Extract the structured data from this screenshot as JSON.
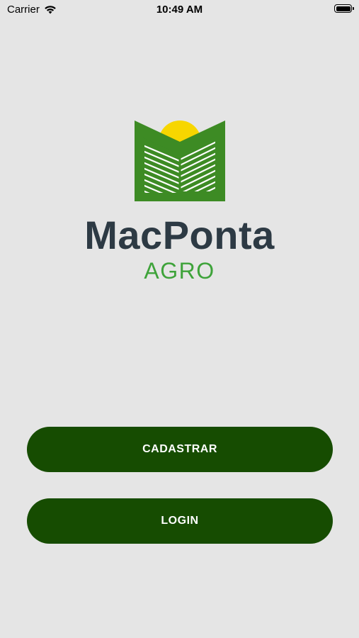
{
  "status_bar": {
    "carrier": "Carrier",
    "time": "10:49 AM",
    "wifi_icon": "wifi-icon",
    "battery_icon": "battery-icon",
    "battery_level": 1.0
  },
  "logo": {
    "icon": "field-sun-logo-icon",
    "brand_name": "MacPonta",
    "brand_sub": "AGRO",
    "colors": {
      "sun": "#f7d600",
      "green": "#3d8b24",
      "dark_text": "#2d3a44",
      "sub_text": "#3ea33a"
    }
  },
  "actions": {
    "register_label": "CADASTRAR",
    "login_label": "LOGIN",
    "button_color": "#164c01"
  }
}
